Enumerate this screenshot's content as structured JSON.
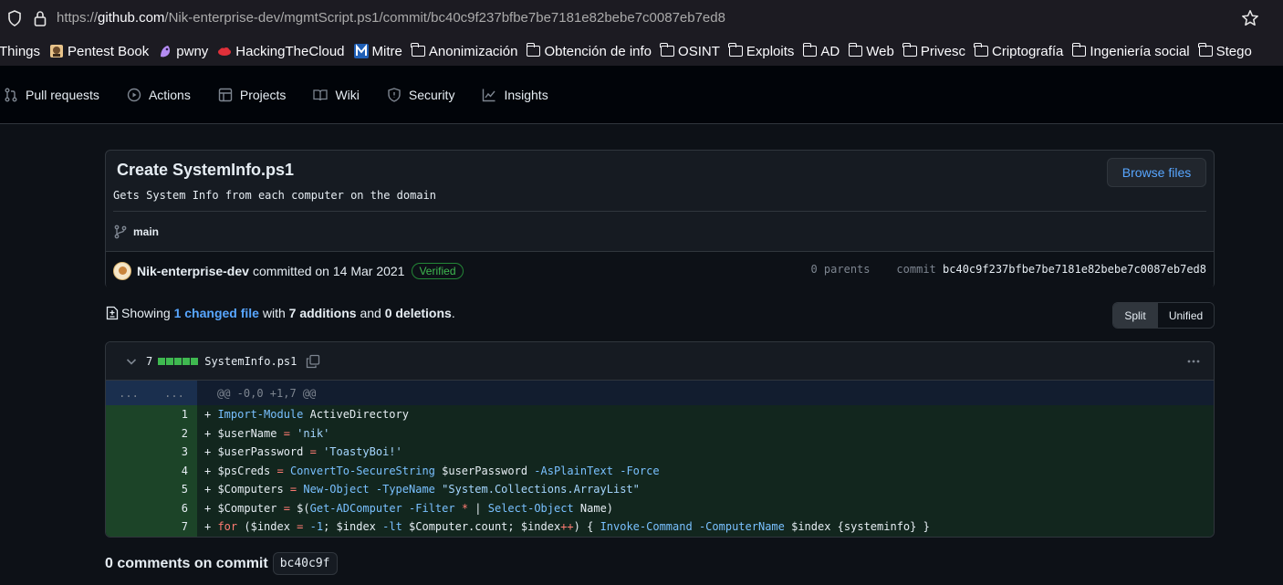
{
  "browser": {
    "url_prefix": "https://",
    "url_host": "github.com",
    "url_path": "/Nik-enterprise-dev/mgmtScript.ps1/commit/bc40c9f237bfbe7be7181e82bebe7c0087eb7ed8",
    "bookmarks": [
      {
        "label": "Things",
        "icon": "none"
      },
      {
        "label": "Pentest Book",
        "icon": "book-favicon"
      },
      {
        "label": "pwny",
        "icon": "pwny-favicon"
      },
      {
        "label": "HackingTheCloud",
        "icon": "cloud-favicon"
      },
      {
        "label": "Mitre",
        "icon": "mitre-favicon"
      },
      {
        "label": "Anonimización",
        "icon": "folder-icon"
      },
      {
        "label": "Obtención de info",
        "icon": "folder-icon"
      },
      {
        "label": "OSINT",
        "icon": "folder-icon"
      },
      {
        "label": "Exploits",
        "icon": "folder-icon"
      },
      {
        "label": "AD",
        "icon": "folder-icon"
      },
      {
        "label": "Web",
        "icon": "folder-icon"
      },
      {
        "label": "Privesc",
        "icon": "folder-icon"
      },
      {
        "label": "Criptografía",
        "icon": "folder-icon"
      },
      {
        "label": "Ingeniería social",
        "icon": "folder-icon"
      },
      {
        "label": "Stego",
        "icon": "folder-icon"
      }
    ]
  },
  "repo_nav": {
    "items": [
      {
        "label": "Pull requests",
        "icon": "pull-request-icon"
      },
      {
        "label": "Actions",
        "icon": "play-icon"
      },
      {
        "label": "Projects",
        "icon": "table-icon"
      },
      {
        "label": "Wiki",
        "icon": "book-icon"
      },
      {
        "label": "Security",
        "icon": "shield-icon"
      },
      {
        "label": "Insights",
        "icon": "graph-icon"
      }
    ]
  },
  "commit": {
    "title": "Create SystemInfo.ps1",
    "description": "Gets System Info from each computer on the domain",
    "browse_label": "Browse files",
    "branch": "main",
    "author": "Nik-enterprise-dev",
    "committed_text": "committed on 14 Mar 2021",
    "verified_label": "Verified",
    "parents_text": "0 parents",
    "commit_label": "commit",
    "sha": "bc40c9f237bfbe7be7181e82bebe7c0087eb7ed8"
  },
  "summary": {
    "showing": "Showing",
    "changed": "1 changed file",
    "with": "with",
    "additions": "7 additions",
    "and": "and",
    "deletions": "0 deletions",
    "end": ".",
    "split_label": "Split",
    "unified_label": "Unified"
  },
  "diff": {
    "count": "7",
    "filename": "SystemInfo.ps1",
    "hunk_old": "...",
    "hunk_new": "...",
    "hunk_header": "@@ -0,0 +1,7 @@",
    "lines": [
      {
        "num": "1",
        "text": "+ Import-Module ActiveDirectory"
      },
      {
        "num": "2",
        "text": "+ $userName = 'nik'"
      },
      {
        "num": "3",
        "text": "+ $userPassword = 'ToastyBoi!'"
      },
      {
        "num": "4",
        "text": "+ $psCreds = ConvertTo-SecureString $userPassword -AsPlainText -Force"
      },
      {
        "num": "5",
        "text": "+ $Computers = New-Object -TypeName \"System.Collections.ArrayList\""
      },
      {
        "num": "6",
        "text": "+ $Computer = $(Get-ADComputer -Filter * | Select-Object Name)"
      },
      {
        "num": "7",
        "text": "+ for ($index = -1; $index -lt $Computer.count; $index++) { Invoke-Command -ComputerName $index {systeminfo} }"
      }
    ]
  },
  "comments": {
    "label": "0 comments on commit",
    "short_sha": "bc40c9f"
  },
  "colors": {
    "accent_link": "#58a6ff",
    "added": "#3fb950",
    "background": "#0d1117"
  }
}
